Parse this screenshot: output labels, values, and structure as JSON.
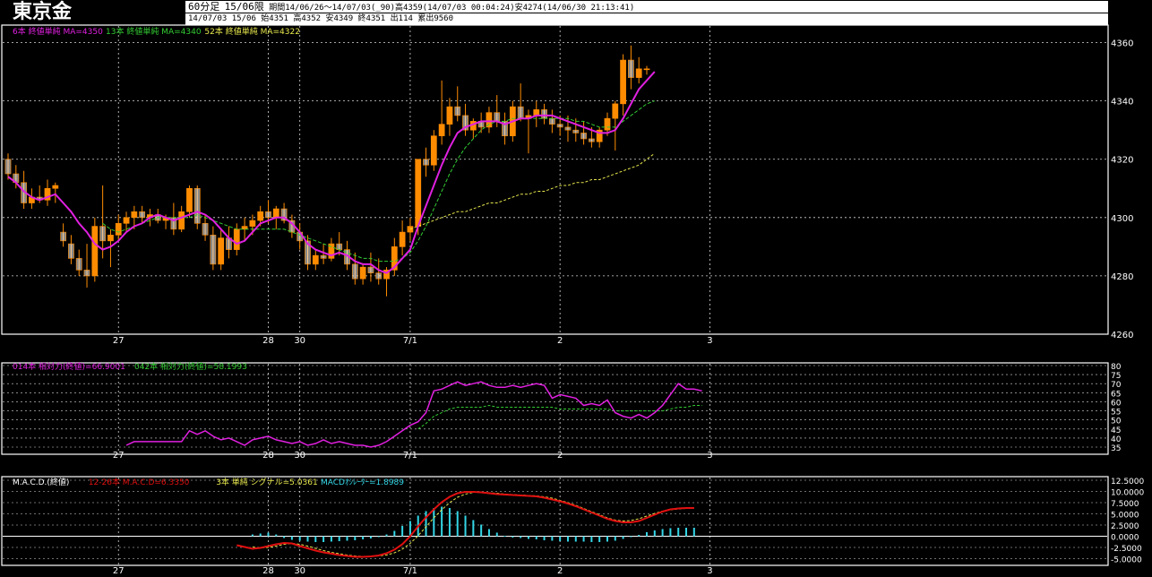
{
  "header": {
    "instrument": "東京金",
    "period": "60分足",
    "contract": "15/06限",
    "range": "期間14/06/26～14/07/03(_90)高4359(14/07/03 00:04:24)安4274(14/06/30 21:13:41)",
    "last_bar": "14/07/03 15/06 始4351 高4352 安4349 終4351 出114 累出9560"
  },
  "colors": {
    "background": "#000000",
    "grid": "#ffffff",
    "up_candle": "#ff8c00",
    "ma_short": "#e020e0",
    "ma_mid": "#33cc33",
    "ma_long": "#e6e64d",
    "rsi_short": "#e020e0",
    "rsi_long": "#33cc33",
    "macd": "#e01010",
    "signal": "#e6e64d",
    "histogram": "#33d6e6"
  },
  "chart_data": [
    {
      "type": "candlestick",
      "legend": [
        {
          "text": "6本 終値単純 MA=4350",
          "color": "#e020e0"
        },
        {
          "text": "13本 終値単純 MA=4340",
          "color": "#33cc33"
        },
        {
          "text": "52本 終値単純 MA=4322",
          "color": "#e6e64d"
        }
      ],
      "ylim": [
        4260,
        4366
      ],
      "y_ticks": [
        4260,
        4280,
        4300,
        4320,
        4340,
        4360
      ],
      "x_ticks": [
        {
          "label": "27",
          "index": 14
        },
        {
          "label": "28",
          "index": 33
        },
        {
          "label": "30",
          "index": 37
        },
        {
          "label": "7/1",
          "index": 51
        },
        {
          "label": "2",
          "index": 70
        },
        {
          "label": "3",
          "index": 89
        }
      ],
      "candles": [
        [
          4320,
          4322,
          4313,
          4315
        ],
        [
          4315,
          4318,
          4310,
          4312
        ],
        [
          4312,
          4316,
          4303,
          4305
        ],
        [
          4305,
          4310,
          4303,
          4307
        ],
        [
          4307,
          4311,
          4305,
          4306
        ],
        [
          4306,
          4313,
          4304,
          4310
        ],
        [
          4310,
          4312,
          4305,
          4311
        ],
        [
          4295,
          4298,
          4290,
          4292
        ],
        [
          4291,
          4294,
          4284,
          4286
        ],
        [
          4286,
          4289,
          4280,
          4282
        ],
        [
          4282,
          4291,
          4276,
          4280
        ],
        [
          4280,
          4300,
          4278,
          4297
        ],
        [
          4297,
          4311,
          4286,
          4292
        ],
        [
          4292,
          4296,
          4283,
          4294
        ],
        [
          4294,
          4301,
          4292,
          4298
        ],
        [
          4298,
          4302,
          4295,
          4300
        ],
        [
          4300,
          4304,
          4296,
          4302
        ],
        [
          4302,
          4304,
          4298,
          4300
        ],
        [
          4300,
          4303,
          4297,
          4301
        ],
        [
          4301,
          4303,
          4298,
          4299
        ],
        [
          4299,
          4301,
          4296,
          4300
        ],
        [
          4300,
          4305,
          4294,
          4296
        ],
        [
          4296,
          4304,
          4295,
          4302
        ],
        [
          4302,
          4311,
          4300,
          4310
        ],
        [
          4310,
          4311,
          4296,
          4298
        ],
        [
          4298,
          4301,
          4292,
          4294
        ],
        [
          4294,
          4297,
          4282,
          4284
        ],
        [
          4284,
          4296,
          4282,
          4293
        ],
        [
          4293,
          4297,
          4286,
          4289
        ],
        [
          4289,
          4298,
          4287,
          4296
        ],
        [
          4296,
          4300,
          4292,
          4297
        ],
        [
          4297,
          4301,
          4294,
          4299
        ],
        [
          4299,
          4304,
          4297,
          4302
        ],
        [
          4302,
          4306,
          4298,
          4300
        ],
        [
          4300,
          4304,
          4296,
          4303
        ],
        [
          4303,
          4305,
          4298,
          4299
        ],
        [
          4299,
          4301,
          4293,
          4295
        ],
        [
          4295,
          4298,
          4289,
          4292
        ],
        [
          4292,
          4294,
          4282,
          4284
        ],
        [
          4284,
          4289,
          4282,
          4287
        ],
        [
          4287,
          4291,
          4284,
          4286
        ],
        [
          4286,
          4293,
          4285,
          4291
        ],
        [
          4291,
          4295,
          4287,
          4289
        ],
        [
          4289,
          4292,
          4282,
          4284
        ],
        [
          4284,
          4288,
          4277,
          4279
        ],
        [
          4279,
          4284,
          4277,
          4283
        ],
        [
          4283,
          4288,
          4278,
          4281
        ],
        [
          4281,
          4286,
          4277,
          4279
        ],
        [
          4279,
          4283,
          4273,
          4282
        ],
        [
          4282,
          4293,
          4280,
          4290
        ],
        [
          4290,
          4299,
          4287,
          4295
        ],
        [
          4295,
          4300,
          4292,
          4297
        ],
        [
          4297,
          4311,
          4294,
          4320
        ],
        [
          4320,
          4324,
          4314,
          4318
        ],
        [
          4318,
          4330,
          4316,
          4328
        ],
        [
          4328,
          4347,
          4325,
          4332
        ],
        [
          4332,
          4341,
          4328,
          4338
        ],
        [
          4338,
          4345,
          4333,
          4335
        ],
        [
          4335,
          4339,
          4328,
          4330
        ],
        [
          4330,
          4334,
          4327,
          4333
        ],
        [
          4333,
          4336,
          4329,
          4331
        ],
        [
          4331,
          4338,
          4329,
          4336
        ],
        [
          4336,
          4342,
          4331,
          4333
        ],
        [
          4333,
          4336,
          4325,
          4328
        ],
        [
          4328,
          4340,
          4326,
          4338
        ],
        [
          4338,
          4346,
          4333,
          4334
        ],
        [
          4334,
          4337,
          4322,
          4335
        ],
        [
          4335,
          4340,
          4331,
          4337
        ],
        [
          4337,
          4339,
          4332,
          4334
        ],
        [
          4334,
          4337,
          4329,
          4332
        ],
        [
          4332,
          4335,
          4328,
          4331
        ],
        [
          4331,
          4335,
          4326,
          4330
        ],
        [
          4330,
          4334,
          4326,
          4329
        ],
        [
          4329,
          4333,
          4325,
          4327
        ],
        [
          4327,
          4331,
          4324,
          4326
        ],
        [
          4326,
          4331,
          4324,
          4330
        ],
        [
          4330,
          4336,
          4328,
          4334
        ],
        [
          4334,
          4340,
          4323,
          4339
        ],
        [
          4339,
          4356,
          4335,
          4354
        ],
        [
          4354,
          4359,
          4344,
          4348
        ],
        [
          4348,
          4355,
          4346,
          4351
        ],
        [
          4351,
          4352,
          4349,
          4351
        ]
      ],
      "ma_short": [
        4314,
        4312,
        4309,
        4307,
        4306,
        4307,
        4308,
        4305,
        4302,
        4298,
        4295,
        4291,
        4289,
        4290,
        4292,
        4295,
        4297,
        4298,
        4300,
        4301,
        4300,
        4299,
        4300,
        4301,
        4302,
        4301,
        4299,
        4296,
        4293,
        4291,
        4292,
        4295,
        4298,
        4299,
        4300,
        4300,
        4298,
        4295,
        4291,
        4289,
        4288,
        4287,
        4288,
        4287,
        4285,
        4284,
        4284,
        4282,
        4281,
        4283,
        4286,
        4289,
        4297,
        4304,
        4311,
        4318,
        4324,
        4329,
        4331,
        4332,
        4333,
        4333,
        4333,
        4332,
        4333,
        4334,
        4334,
        4335,
        4335,
        4335,
        4334,
        4333,
        4332,
        4331,
        4330,
        4329,
        4329,
        4330,
        4334,
        4339,
        4344,
        4347,
        4350
      ],
      "ma_mid": [
        null,
        null,
        null,
        null,
        null,
        null,
        null,
        null,
        null,
        null,
        null,
        null,
        4298,
        4296,
        4295,
        4296,
        4297,
        4298,
        4299,
        4300,
        4300,
        4300,
        4300,
        4300,
        4301,
        4300,
        4299,
        4298,
        4297,
        4296,
        4296,
        4296,
        4296,
        4296,
        4296,
        4296,
        4295,
        4294,
        4293,
        4292,
        4291,
        4290,
        4289,
        4288,
        4287,
        4286,
        4286,
        4285,
        4285,
        4285,
        4286,
        4288,
        4292,
        4297,
        4303,
        4309,
        4315,
        4320,
        4324,
        4327,
        4330,
        4332,
        4333,
        4333,
        4334,
        4334,
        4334,
        4334,
        4334,
        4334,
        4334,
        4334,
        4333,
        4333,
        4332,
        4331,
        4331,
        4331,
        4333,
        4335,
        4337,
        4339,
        4340
      ],
      "ma_long": [
        null,
        null,
        null,
        null,
        null,
        null,
        null,
        null,
        null,
        null,
        null,
        null,
        null,
        null,
        null,
        null,
        null,
        null,
        null,
        null,
        null,
        null,
        null,
        null,
        null,
        null,
        null,
        null,
        null,
        null,
        null,
        null,
        null,
        null,
        null,
        null,
        null,
        null,
        null,
        null,
        null,
        null,
        null,
        null,
        null,
        null,
        null,
        null,
        null,
        null,
        null,
        4296,
        4297,
        4298,
        4299,
        4300,
        4301,
        4302,
        4302,
        4303,
        4304,
        4305,
        4305,
        4306,
        4307,
        4308,
        4308,
        4309,
        4309,
        4310,
        4311,
        4311,
        4312,
        4312,
        4313,
        4313,
        4314,
        4315,
        4316,
        4317,
        4318,
        4320,
        4322
      ]
    },
    {
      "type": "line",
      "legend": [
        {
          "text": "014本 相対力(終値)=66.9001",
          "color": "#e020e0"
        },
        {
          "text": "042本 相対力(終値)=58.1993",
          "color": "#33cc33"
        }
      ],
      "ylim": [
        35,
        80
      ],
      "y_ticks": [
        35,
        40,
        45,
        50,
        55,
        60,
        65,
        70,
        75,
        80
      ],
      "rsi_short": [
        null,
        null,
        null,
        null,
        null,
        null,
        null,
        null,
        null,
        null,
        null,
        null,
        null,
        null,
        null,
        36,
        38,
        38,
        38,
        38,
        38,
        38,
        38,
        44,
        42,
        44,
        41,
        39,
        40,
        38,
        36,
        39,
        40,
        41,
        39,
        38,
        37,
        38,
        36,
        37,
        39,
        37,
        38,
        37,
        36,
        36,
        35,
        36,
        38,
        41,
        44,
        47,
        49,
        54,
        66,
        67,
        69,
        71,
        69,
        70,
        71,
        69,
        68,
        68,
        69,
        68,
        69,
        70,
        69,
        62,
        64,
        63,
        62,
        58,
        59,
        58,
        61,
        54,
        52,
        51,
        53,
        51,
        54,
        58,
        64,
        70,
        67,
        67,
        66
      ],
      "rsi_long": [
        null,
        null,
        null,
        null,
        null,
        null,
        null,
        null,
        null,
        null,
        null,
        null,
        null,
        null,
        null,
        null,
        null,
        null,
        null,
        null,
        null,
        null,
        null,
        null,
        null,
        null,
        null,
        null,
        null,
        null,
        null,
        null,
        null,
        null,
        null,
        null,
        null,
        null,
        null,
        null,
        null,
        null,
        null,
        null,
        null,
        null,
        null,
        null,
        null,
        null,
        null,
        null,
        45,
        48,
        52,
        54,
        56,
        57,
        57,
        57,
        57,
        58,
        57,
        57,
        57,
        57,
        57,
        57,
        57,
        57,
        56,
        56,
        56,
        56,
        56,
        56,
        56,
        55,
        55,
        55,
        55,
        55,
        55,
        55,
        56,
        57,
        57,
        58,
        58
      ]
    },
    {
      "type": "line_bar",
      "legend": [
        {
          "text": "M.A.C.D.(終値)",
          "color": "#ffffff"
        },
        {
          "text": "12-26本 M.A.C.D=6.3350",
          "color": "#e01010"
        },
        {
          "text": "3本 単純 シグナル=5.0361",
          "color": "#e6e64d"
        },
        {
          "text": "MACDｵｼﾚｰﾀｰ=1.8989",
          "color": "#33d6e6"
        }
      ],
      "ylim": [
        -5.5,
        12.5
      ],
      "y_ticks": [
        "12.5000",
        "10.0000",
        "7.5000",
        "5.0000",
        "2.5000",
        "0.0000",
        "-2.5000",
        "-5.0000"
      ],
      "macd": [
        null,
        null,
        null,
        null,
        null,
        null,
        null,
        null,
        null,
        null,
        null,
        null,
        null,
        null,
        null,
        null,
        null,
        null,
        null,
        null,
        null,
        null,
        null,
        null,
        null,
        null,
        null,
        null,
        null,
        -2.0,
        -2.4,
        -2.8,
        -2.6,
        -2.2,
        -1.8,
        -1.5,
        -1.6,
        -2.2,
        -2.7,
        -3.2,
        -3.6,
        -3.9,
        -4.2,
        -4.4,
        -4.6,
        -4.6,
        -4.5,
        -4.3,
        -3.8,
        -3.0,
        -1.8,
        0.0,
        2.2,
        4.2,
        6.0,
        7.6,
        8.8,
        9.6,
        9.9,
        9.9,
        9.8,
        9.6,
        9.4,
        9.3,
        9.2,
        9.1,
        9.0,
        8.9,
        8.6,
        8.2,
        7.8,
        7.3,
        6.7,
        6.0,
        5.3,
        4.6,
        3.9,
        3.4,
        3.1,
        3.1,
        3.4,
        4.1,
        4.8,
        5.5,
        6.0,
        6.2,
        6.3,
        6.3
      ],
      "signal": [
        null,
        null,
        null,
        null,
        null,
        null,
        null,
        null,
        null,
        null,
        null,
        null,
        null,
        null,
        null,
        null,
        null,
        null,
        null,
        null,
        null,
        null,
        null,
        null,
        null,
        null,
        null,
        null,
        null,
        null,
        null,
        -2.4,
        -2.6,
        -2.5,
        -2.2,
        -1.8,
        -1.6,
        -1.8,
        -2.2,
        -2.7,
        -3.2,
        -3.6,
        -3.9,
        -4.2,
        -4.4,
        -4.5,
        -4.5,
        -4.4,
        -4.2,
        -3.7,
        -2.9,
        -1.6,
        0.1,
        2.1,
        4.1,
        5.9,
        7.5,
        8.7,
        9.4,
        9.8,
        9.8,
        9.7,
        9.6,
        9.4,
        9.3,
        9.2,
        9.1,
        9.0,
        8.8,
        8.5,
        8.0,
        7.5,
        6.9,
        6.2,
        5.5,
        4.8,
        4.1,
        3.6,
        3.4,
        3.5,
        3.9,
        4.5,
        5.1,
        5.6,
        5.9,
        6.1,
        6.2,
        6.3
      ],
      "histogram": [
        null,
        null,
        null,
        null,
        null,
        null,
        null,
        null,
        null,
        null,
        null,
        null,
        null,
        null,
        null,
        null,
        null,
        null,
        null,
        null,
        null,
        null,
        null,
        null,
        null,
        null,
        null,
        null,
        null,
        null,
        null,
        0.4,
        0.6,
        0.8,
        0.4,
        -0.4,
        -0.8,
        -1.0,
        -1.2,
        -1.3,
        -1.3,
        -1.2,
        -1.1,
        -1.0,
        -0.9,
        -0.7,
        -0.5,
        -0.2,
        0.4,
        1.2,
        2.3,
        3.4,
        4.6,
        5.6,
        6.3,
        6.6,
        6.3,
        5.6,
        4.6,
        3.6,
        2.6,
        1.6,
        0.8,
        0.1,
        -0.3,
        -0.4,
        -0.6,
        -0.7,
        -0.9,
        -1.0,
        -1.1,
        -1.2,
        -1.2,
        -1.2,
        -1.3,
        -1.3,
        -1.2,
        -1.0,
        -0.6,
        -0.2,
        0.3,
        0.9,
        1.3,
        1.6,
        1.8,
        1.9,
        1.9,
        1.9
      ]
    }
  ]
}
